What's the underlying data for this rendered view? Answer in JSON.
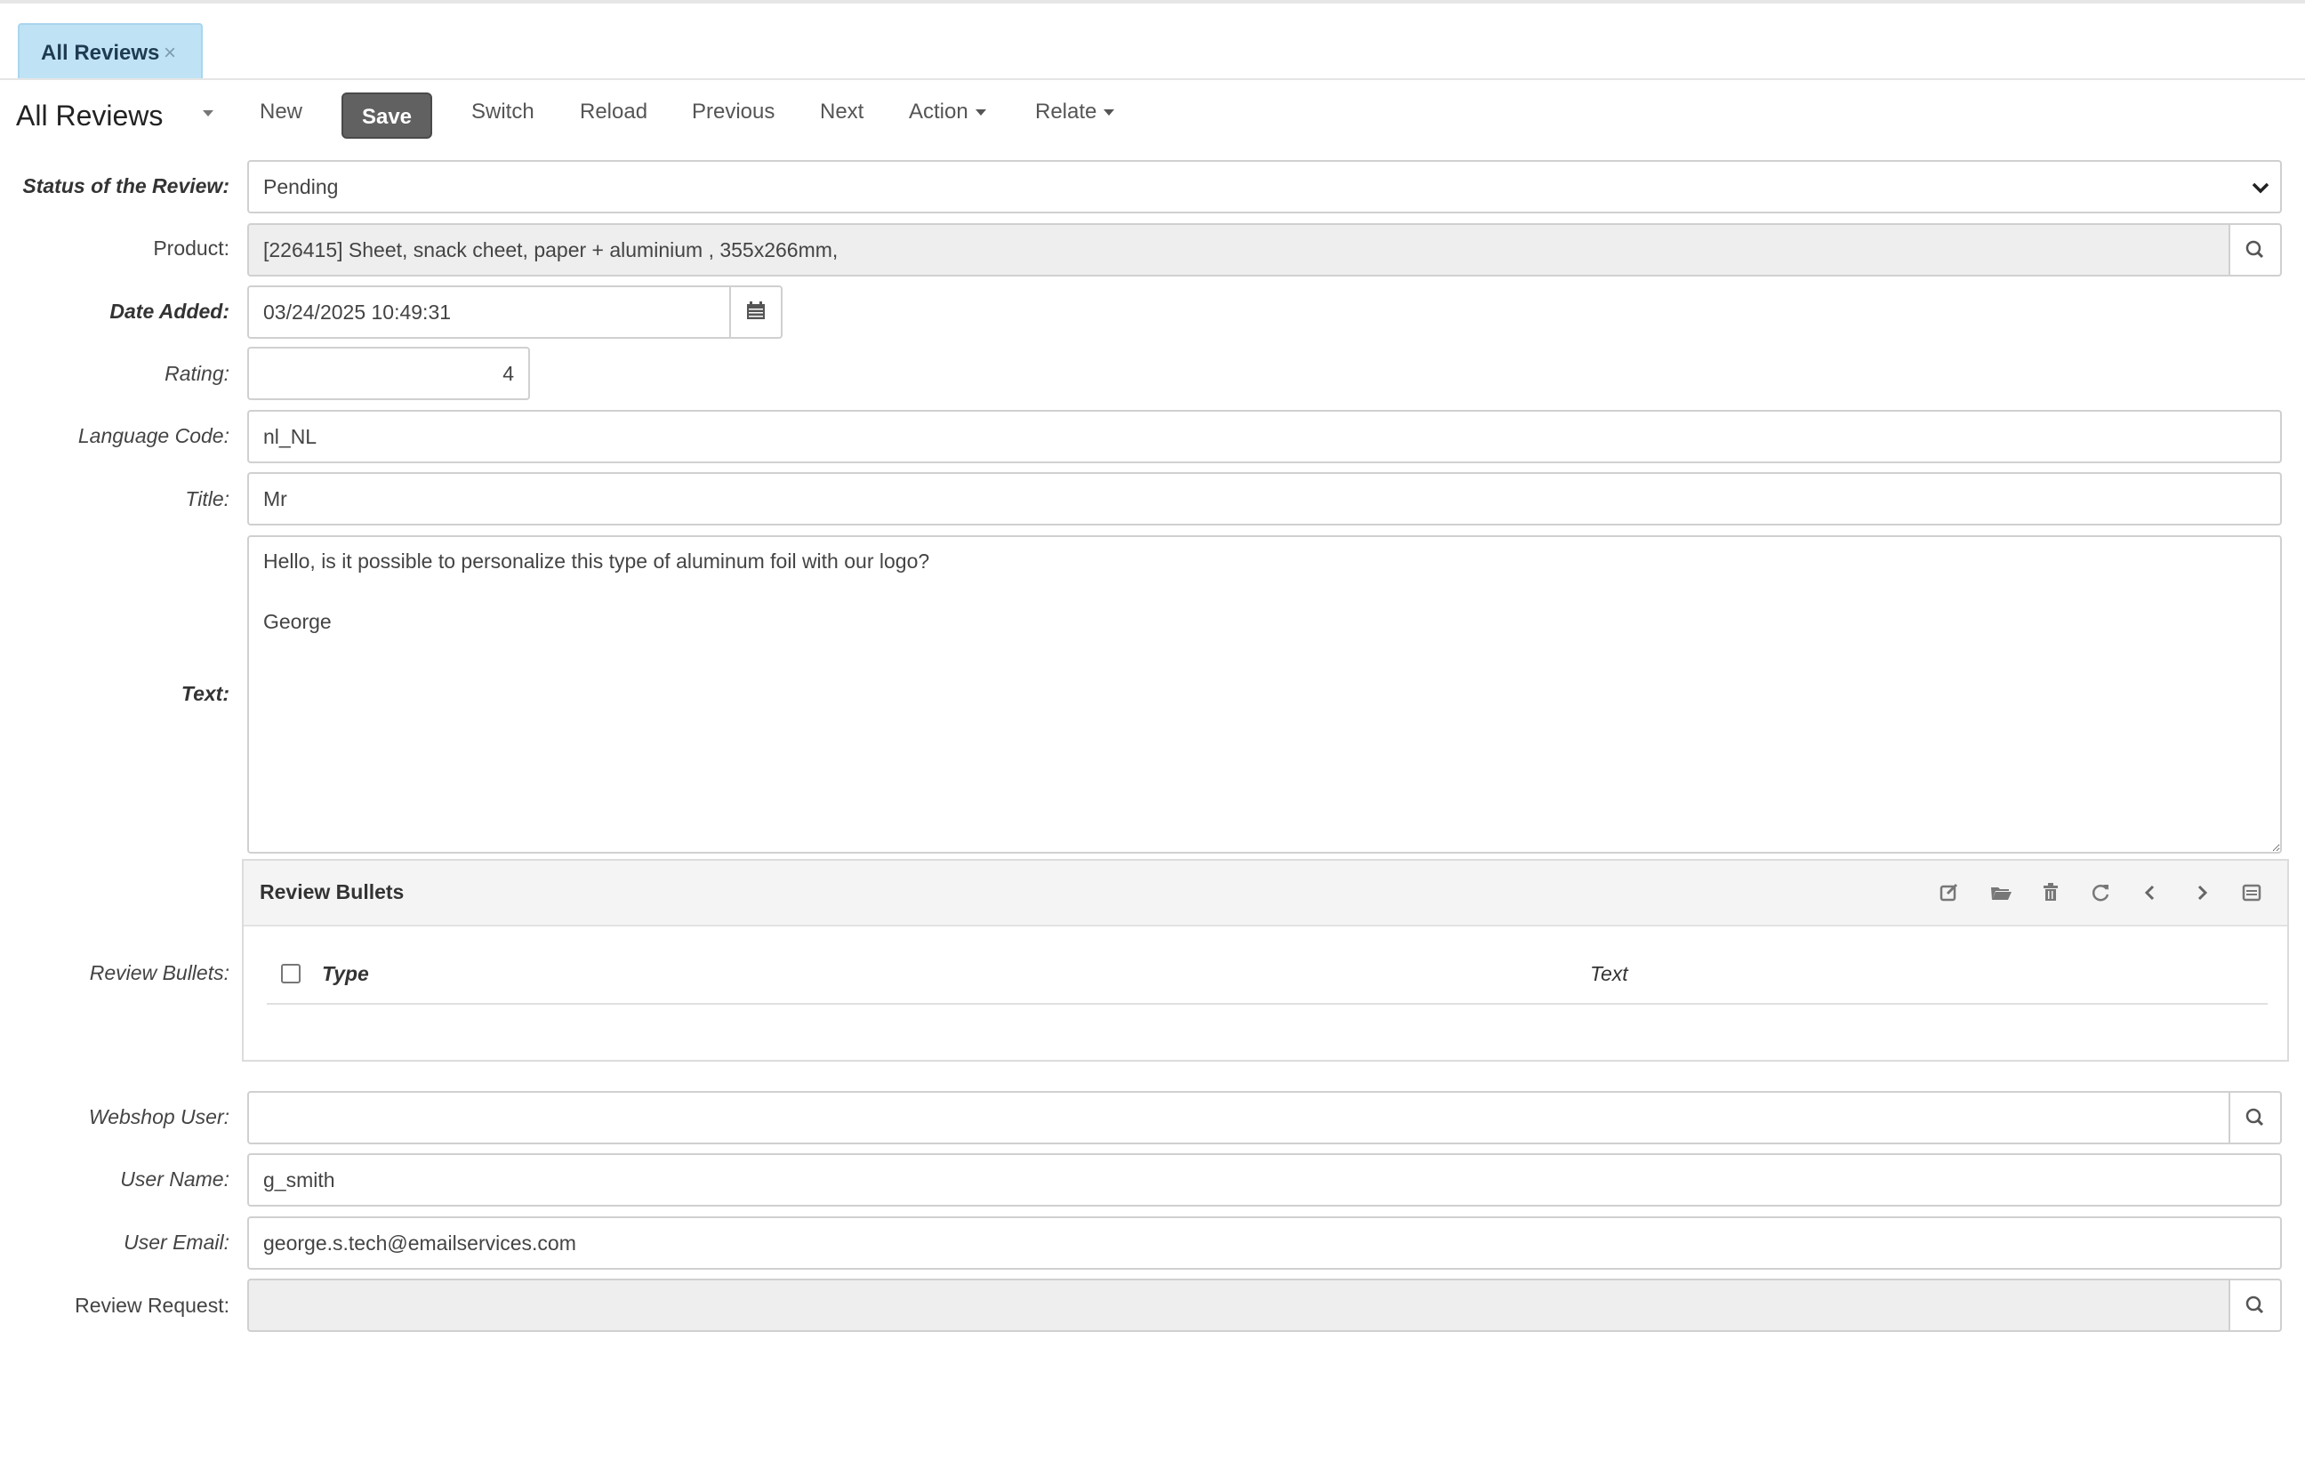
{
  "tab": {
    "label": "All Reviews",
    "close": "×"
  },
  "toolbar": {
    "view_title": "All Reviews",
    "new": "New",
    "save": "Save",
    "switch": "Switch",
    "reload": "Reload",
    "previous": "Previous",
    "next": "Next",
    "action": "Action",
    "relate": "Relate"
  },
  "form": {
    "status": {
      "label": "Status of the Review:",
      "value": "Pending"
    },
    "product": {
      "label": "Product:",
      "value": "[226415] Sheet, snack cheet, paper + aluminium , 355x266mm,"
    },
    "date_added": {
      "label": "Date Added:",
      "value": "03/24/2025 10:49:31"
    },
    "rating": {
      "label": "Rating:",
      "value": "4"
    },
    "language_code": {
      "label": "Language Code:",
      "value": "nl_NL"
    },
    "title": {
      "label": "Title:",
      "value": "Mr"
    },
    "text": {
      "label": "Text:",
      "value": "Hello, is it possible to personalize this type of aluminum foil with our logo?\n\nGeorge"
    },
    "review_bullets": {
      "label": "Review Bullets:",
      "panel_title": "Review Bullets",
      "columns": [
        "Type",
        "Text"
      ]
    },
    "webshop_user": {
      "label": "Webshop User:",
      "value": ""
    },
    "user_name": {
      "label": "User Name:",
      "value": "g_smith"
    },
    "user_email": {
      "label": "User Email:",
      "value": "george.s.tech@emailservices.com"
    },
    "review_request": {
      "label": "Review Request:",
      "value": ""
    }
  },
  "icons": {
    "panel": [
      "new-record-icon",
      "open-folder-icon",
      "trash-icon",
      "refresh-icon",
      "chevron-left-icon",
      "chevron-right-icon",
      "list-icon"
    ],
    "lookup": "search-icon",
    "calendar": "calendar-icon"
  },
  "colors": {
    "tab_active": "#bfe3f5",
    "save_button": "#616161"
  }
}
